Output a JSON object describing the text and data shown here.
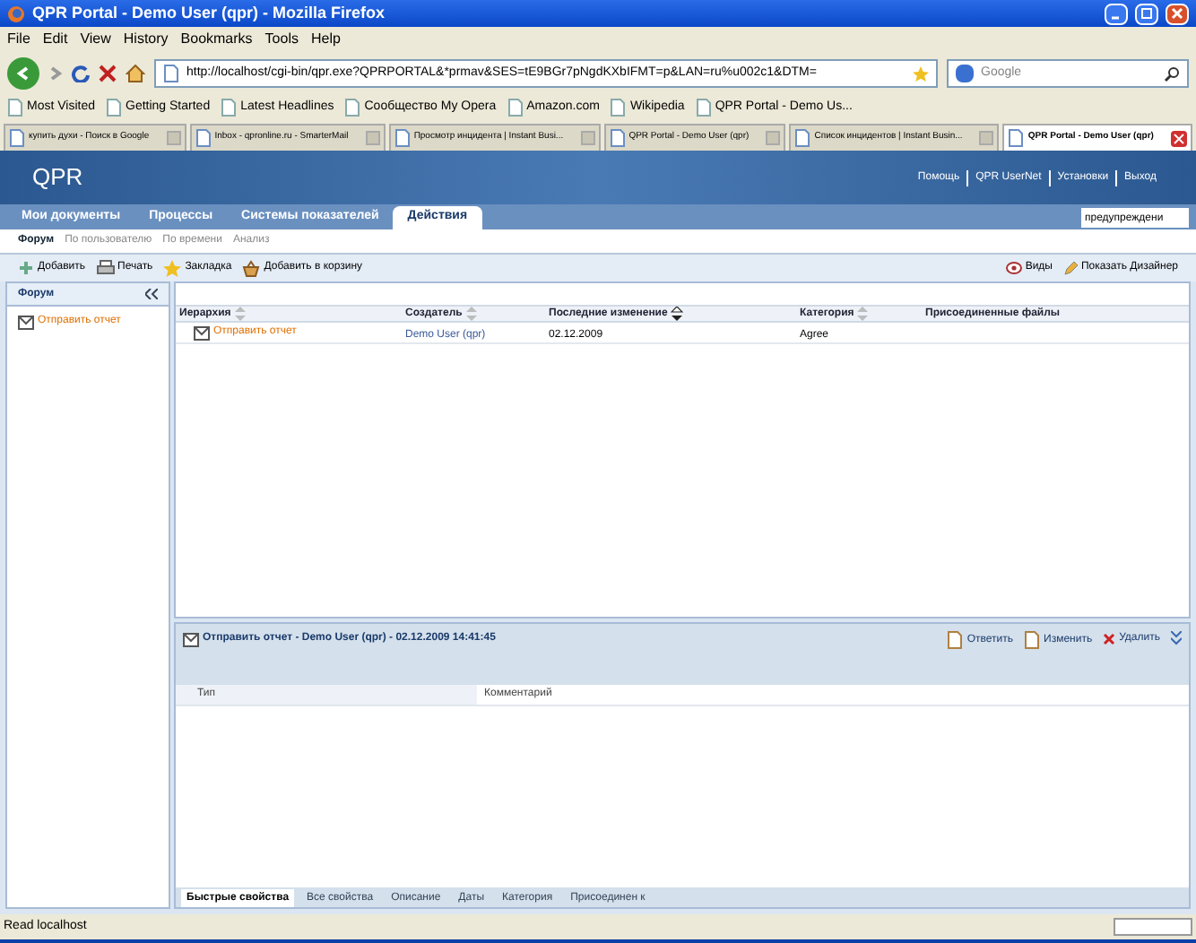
{
  "window": {
    "title": "QPR Portal - Demo User (qpr) - Mozilla Firefox"
  },
  "menu": [
    "File",
    "Edit",
    "View",
    "History",
    "Bookmarks",
    "Tools",
    "Help"
  ],
  "nav": {
    "url": "http://localhost/cgi-bin/qpr.exe?QPRPORTAL&*prmav&SES=tE9BGr7pNgdKXbIFMT=p&LAN=ru%u002c1&DTM=",
    "search_placeholder": "Google"
  },
  "bookmarks": [
    "Most Visited",
    "Getting Started",
    "Latest Headlines",
    "Сообщество My Opera",
    "Amazon.com",
    "Wikipedia",
    "QPR Portal - Demo Us..."
  ],
  "browser_tabs": [
    {
      "label": "купить духи - Поиск в Google",
      "selected": false
    },
    {
      "label": "Inbox - qpronline.ru - SmarterMail",
      "selected": false
    },
    {
      "label": "Просмотр инцидента | Instant Busi...",
      "selected": false
    },
    {
      "label": "QPR Portal - Demo User (qpr)",
      "selected": false
    },
    {
      "label": "Список инцидентов | Instant Busin...",
      "selected": false
    },
    {
      "label": "QPR Portal - Demo User (qpr)",
      "selected": true
    }
  ],
  "portal": {
    "logo": "QPR",
    "header_links": [
      "Помощь",
      "QPR UserNet",
      "Установки",
      "Выход"
    ],
    "main_tabs": [
      {
        "label": "Мои документы",
        "selected": false
      },
      {
        "label": "Процессы",
        "selected": false
      },
      {
        "label": "Системы показателей",
        "selected": false
      },
      {
        "label": "Действия",
        "selected": true
      }
    ],
    "search_value": "предупреждени",
    "sub_tabs": [
      {
        "label": "Форум",
        "selected": true
      },
      {
        "label": "По пользователю",
        "selected": false
      },
      {
        "label": "По времени",
        "selected": false
      },
      {
        "label": "Анализ",
        "selected": false
      }
    ],
    "toolbar_left": [
      "Добавить",
      "Печать",
      "Закладка",
      "Добавить в корзину"
    ],
    "toolbar_right": [
      "Виды",
      "Показать Дизайнер"
    ],
    "sidebar": {
      "title": "Форум",
      "items": [
        "Отправить отчет"
      ]
    },
    "table": {
      "columns": [
        {
          "label": "Иерархия",
          "sorted": false
        },
        {
          "label": "Создатель",
          "sorted": false
        },
        {
          "label": "Последние изменение",
          "sorted": true
        },
        {
          "label": "Категория",
          "sorted": false
        },
        {
          "label": "Присоединенные файлы"
        }
      ],
      "rows": [
        {
          "hierarchy": "Отправить отчет",
          "creator": "Demo User (qpr)",
          "modified": "02.12.2009",
          "category": "Agree"
        }
      ]
    },
    "detail": {
      "title": "Отправить отчет - Demo User (qpr) - 02.12.2009 14:41:45",
      "actions": [
        "Ответить",
        "Изменить",
        "Удалить"
      ],
      "columns": [
        "Тип",
        "Комментарий"
      ],
      "tabs": [
        {
          "label": "Быстрые свойства",
          "selected": true
        },
        {
          "label": "Все свойства",
          "selected": false
        },
        {
          "label": "Описание",
          "selected": false
        },
        {
          "label": "Даты",
          "selected": false
        },
        {
          "label": "Категория",
          "selected": false
        },
        {
          "label": "Присоединен к",
          "selected": false
        }
      ]
    }
  },
  "status_bar": {
    "text": "Read localhost"
  }
}
